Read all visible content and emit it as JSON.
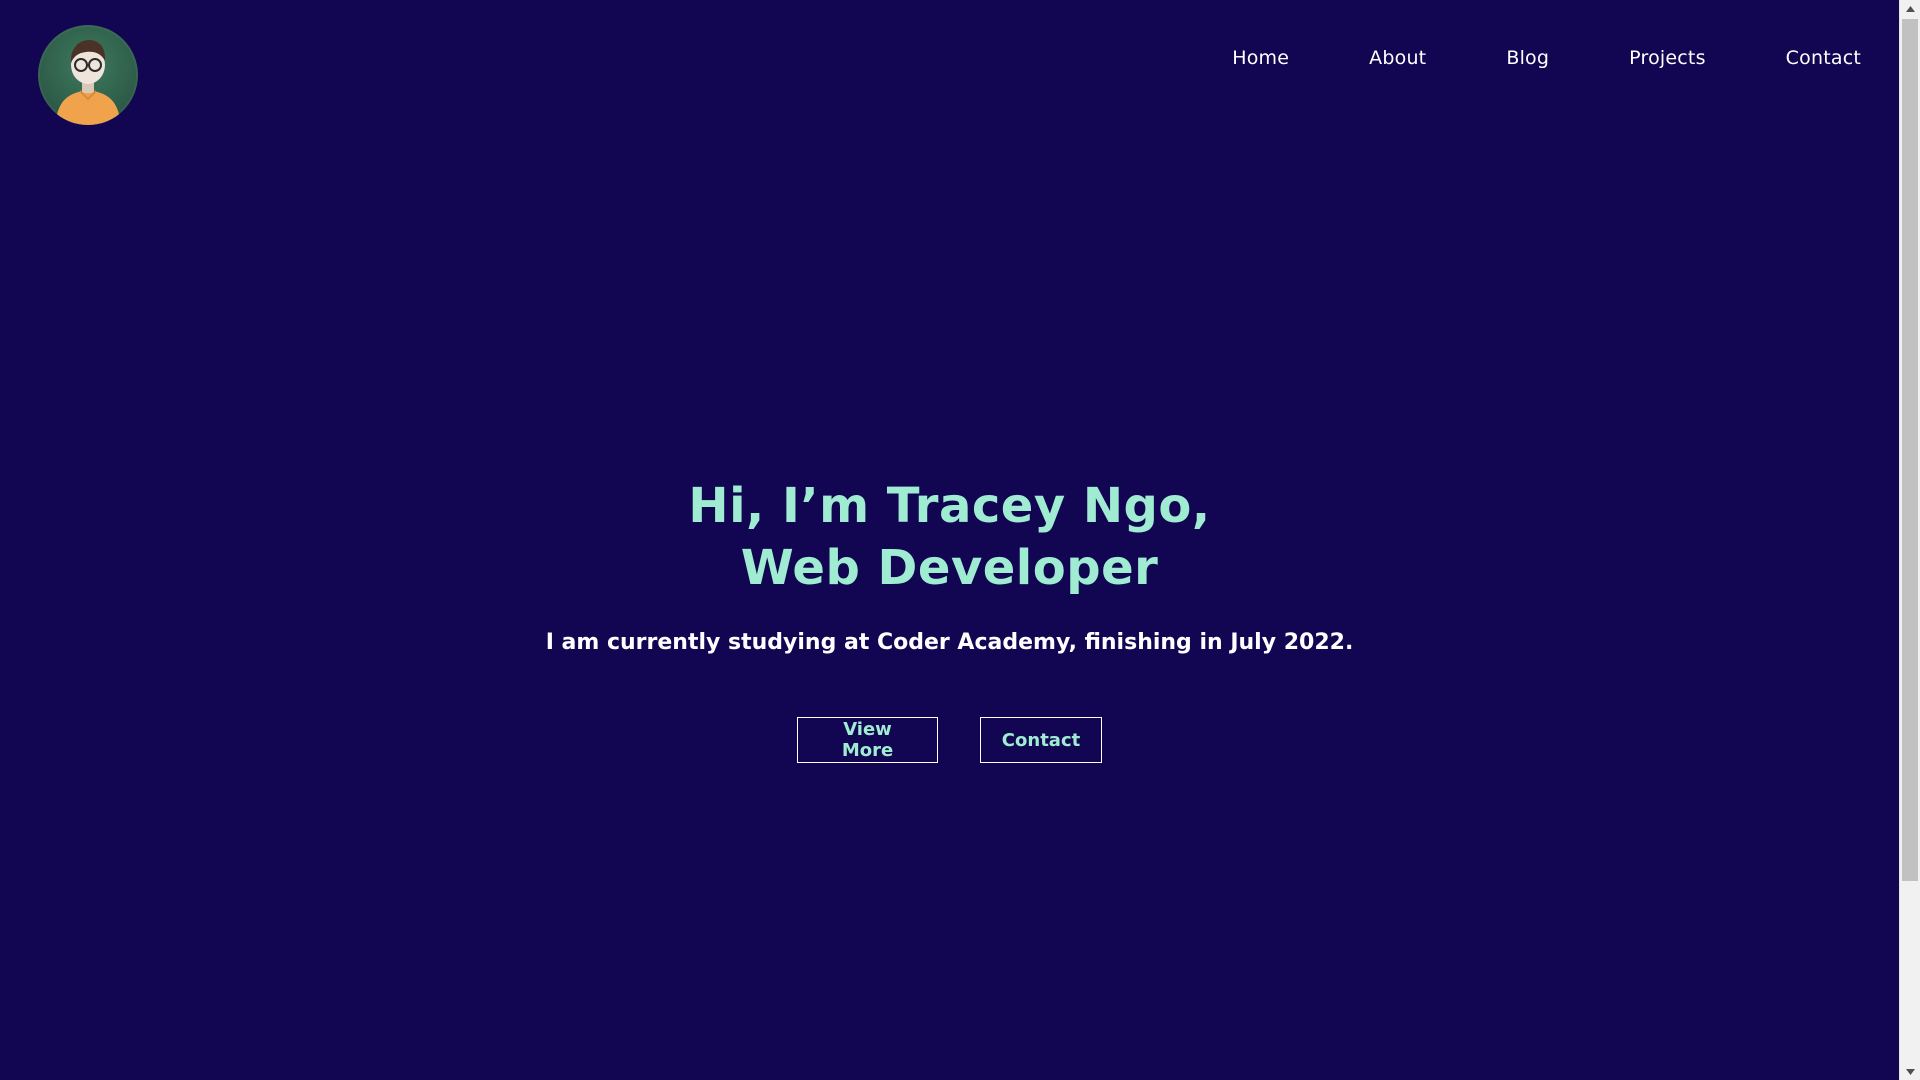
{
  "site": {
    "background_color": "#120652",
    "accent_color": "#a0ecd2"
  },
  "header": {
    "avatar_icon": "person-avatar-icon",
    "nav": [
      {
        "label": "Home"
      },
      {
        "label": "About"
      },
      {
        "label": "Blog"
      },
      {
        "label": "Projects"
      },
      {
        "label": "Contact"
      }
    ]
  },
  "hero": {
    "title_line1": "Hi, I’m Tracey Ngo,",
    "title_line2": "Web Developer",
    "subtitle": "I am currently studying at Coder Academy, finishing in July 2022.",
    "buttons": {
      "view_more": "View More",
      "contact": "Contact"
    }
  },
  "scrollbar": {
    "up_icon": "scroll-up-arrow-icon",
    "down_icon": "scroll-down-arrow-icon"
  }
}
